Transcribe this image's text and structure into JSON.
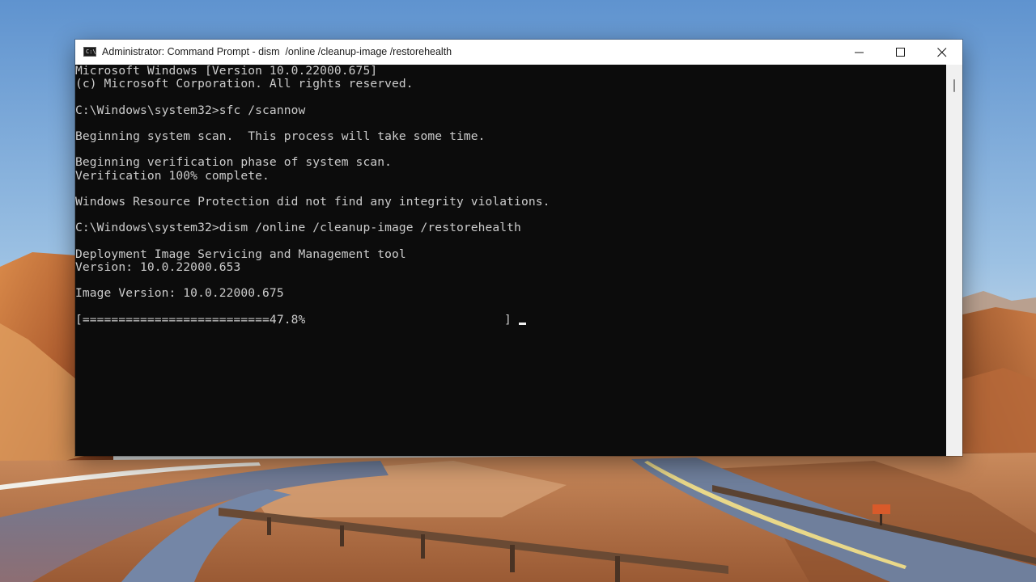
{
  "window": {
    "title": "Administrator: Command Prompt - dism  /online /cleanup-image /restorehealth",
    "icon": "command-prompt-icon",
    "controls": [
      "minimize-icon",
      "maximize-icon",
      "close-icon"
    ]
  },
  "console": {
    "lines": [
      "Microsoft Windows [Version 10.0.22000.675]",
      "(c) Microsoft Corporation. All rights reserved.",
      "",
      "C:\\Windows\\system32>sfc /scannow",
      "",
      "Beginning system scan.  This process will take some time.",
      "",
      "Beginning verification phase of system scan.",
      "Verification 100% complete.",
      "",
      "Windows Resource Protection did not find any integrity violations.",
      "",
      "C:\\Windows\\system32>dism /online /cleanup-image /restorehealth",
      "",
      "Deployment Image Servicing and Management tool",
      "Version: 10.0.22000.653",
      "",
      "Image Version: 10.0.22000.675",
      "",
      "[==========================47.8%"
    ],
    "progress_close": "]",
    "progress_percent": 47.8
  },
  "colors": {
    "console_background": "#0c0c0c",
    "console_text": "#cccccc",
    "titlebar_background": "#ffffff"
  }
}
